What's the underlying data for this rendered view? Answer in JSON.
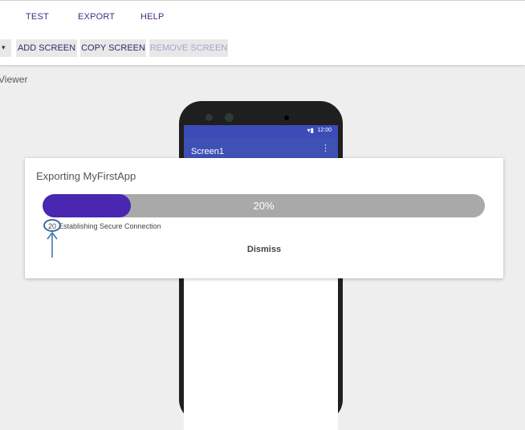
{
  "menu": {
    "items": [
      {
        "label": "TEST"
      },
      {
        "label": "EXPORT"
      },
      {
        "label": "HELP"
      }
    ]
  },
  "toolbar": {
    "add_screen": "ADD SCREEN",
    "copy_screen": "COPY SCREEN",
    "remove_screen": "REMOVE SCREEN"
  },
  "viewer": {
    "label": "Viewer"
  },
  "phone": {
    "time": "12:00",
    "screen_title": "Screen1",
    "menu_icon": "more-vert-icon",
    "status_icons": "wifi-icon battery-icon"
  },
  "dialog": {
    "title": "Exporting MyFirstApp",
    "progress_percent": 20,
    "progress_label": "20%",
    "step_code": "20",
    "step_text": "Establishing Secure Connection",
    "dismiss_label": "Dismiss"
  },
  "colors": {
    "accent": "#4a27b0",
    "app_bar": "#3f51b5",
    "menu_text": "#4a2a8a",
    "annotation": "#3a6ea8"
  }
}
